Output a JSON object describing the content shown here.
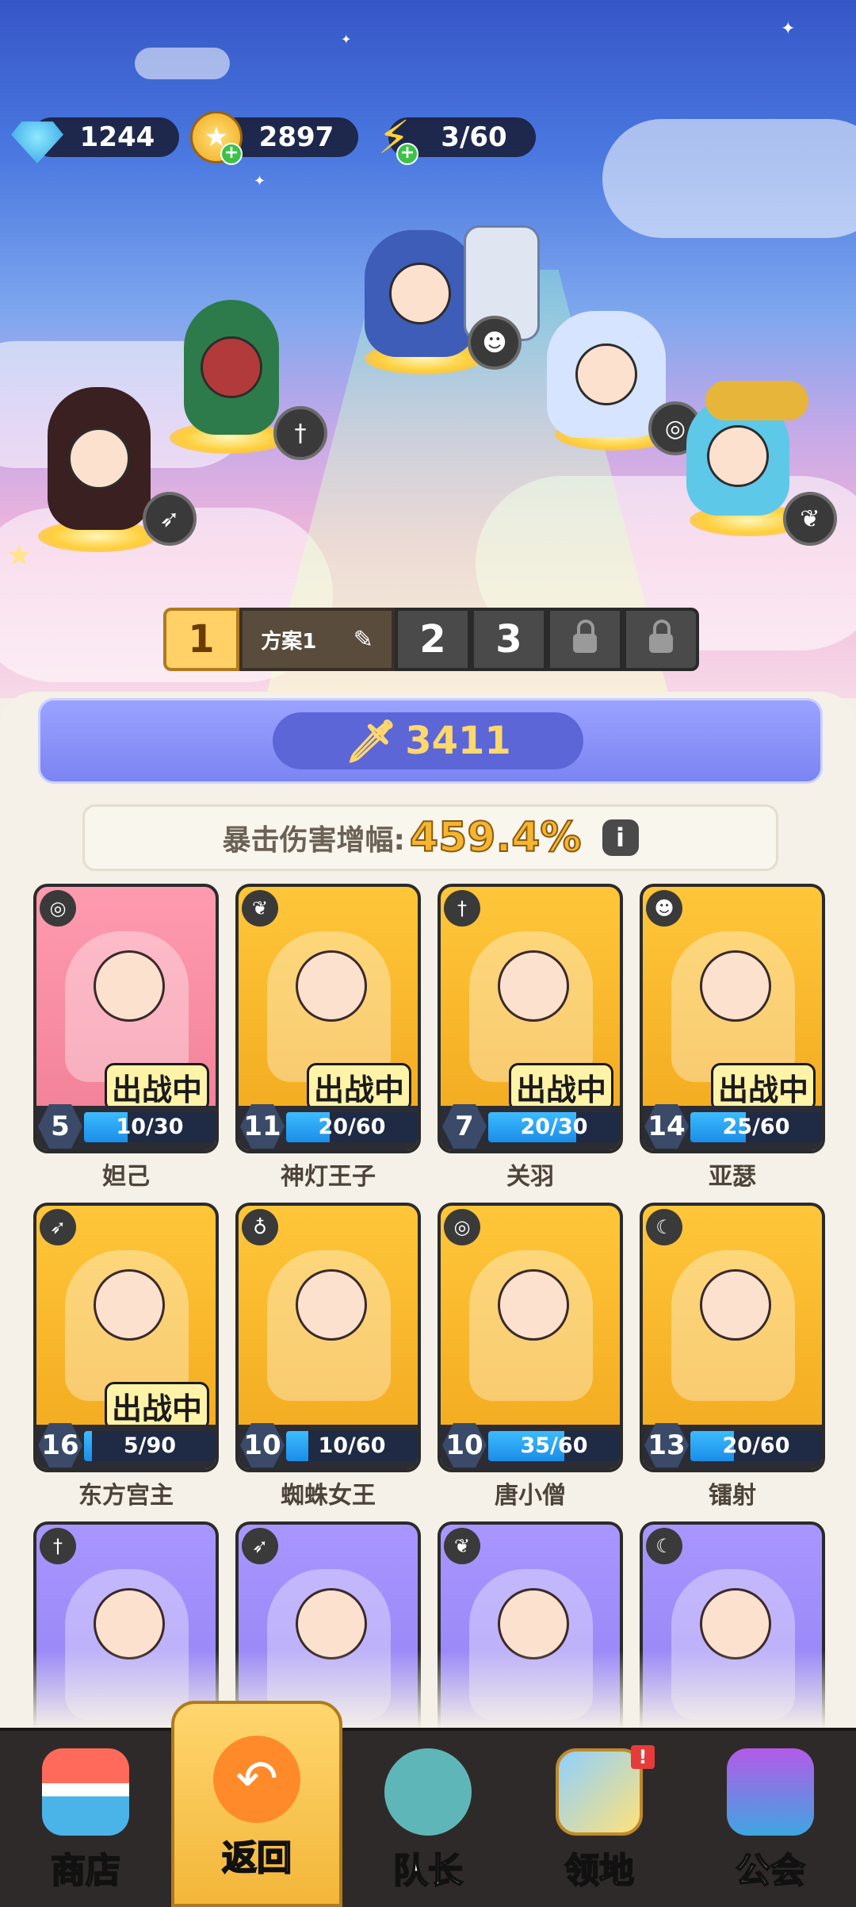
{
  "resources": {
    "gems": "1244",
    "gold": "2897",
    "energy": "3/60"
  },
  "plan_selector": {
    "active": "1",
    "plan_name": "方案1",
    "slot2": "2",
    "slot3": "3"
  },
  "power": "3411",
  "stat": {
    "label": "暴击伤害增幅:",
    "value": "459.4%",
    "info": "i"
  },
  "heroes": [
    {
      "name": "妲己",
      "level": "5",
      "progress": "10/30",
      "fraction": 0.33,
      "deployed": "出战中",
      "type_icon": "spiral-icon",
      "card": "pink"
    },
    {
      "name": "神灯王子",
      "level": "11",
      "progress": "20/60",
      "fraction": 0.33,
      "deployed": "出战中",
      "type_icon": "wings-icon",
      "card": "gold"
    },
    {
      "name": "关羽",
      "level": "7",
      "progress": "20/30",
      "fraction": 0.67,
      "deployed": "出战中",
      "type_icon": "sword-icon",
      "card": "gold"
    },
    {
      "name": "亚瑟",
      "level": "14",
      "progress": "25/60",
      "fraction": 0.42,
      "deployed": "出战中",
      "type_icon": "mask-icon",
      "card": "gold"
    },
    {
      "name": "东方宫主",
      "level": "16",
      "progress": "5/90",
      "fraction": 0.06,
      "deployed": "出战中",
      "type_icon": "bow-icon",
      "card": "gold"
    },
    {
      "name": "蜘蛛女王",
      "level": "10",
      "progress": "10/60",
      "fraction": 0.17,
      "deployed": "",
      "type_icon": "potion-icon",
      "card": "gold"
    },
    {
      "name": "唐小僧",
      "level": "10",
      "progress": "35/60",
      "fraction": 0.58,
      "deployed": "",
      "type_icon": "spiral-icon",
      "card": "gold"
    },
    {
      "name": "镭射",
      "level": "13",
      "progress": "20/60",
      "fraction": 0.33,
      "deployed": "",
      "type_icon": "scythe-icon",
      "card": "gold"
    },
    {
      "name": "",
      "level": "",
      "progress": "",
      "fraction": 0,
      "deployed": "",
      "type_icon": "sword-icon",
      "card": "purple"
    },
    {
      "name": "",
      "level": "",
      "progress": "",
      "fraction": 0,
      "deployed": "",
      "type_icon": "bow-icon",
      "card": "purple"
    },
    {
      "name": "",
      "level": "",
      "progress": "",
      "fraction": 0,
      "deployed": "",
      "type_icon": "wings-icon",
      "card": "purple"
    },
    {
      "name": "",
      "level": "",
      "progress": "",
      "fraction": 0,
      "deployed": "",
      "type_icon": "scythe-icon",
      "card": "purple"
    }
  ],
  "nav": {
    "shop": "商店",
    "back": "返回",
    "captain": "队长",
    "territory": "领地",
    "guild": "公会",
    "alert": "!"
  },
  "colors": {
    "accent_gold": "#ffc63a",
    "progress_blue": "#1a8de8",
    "stat_yellow": "#f5b52f"
  }
}
